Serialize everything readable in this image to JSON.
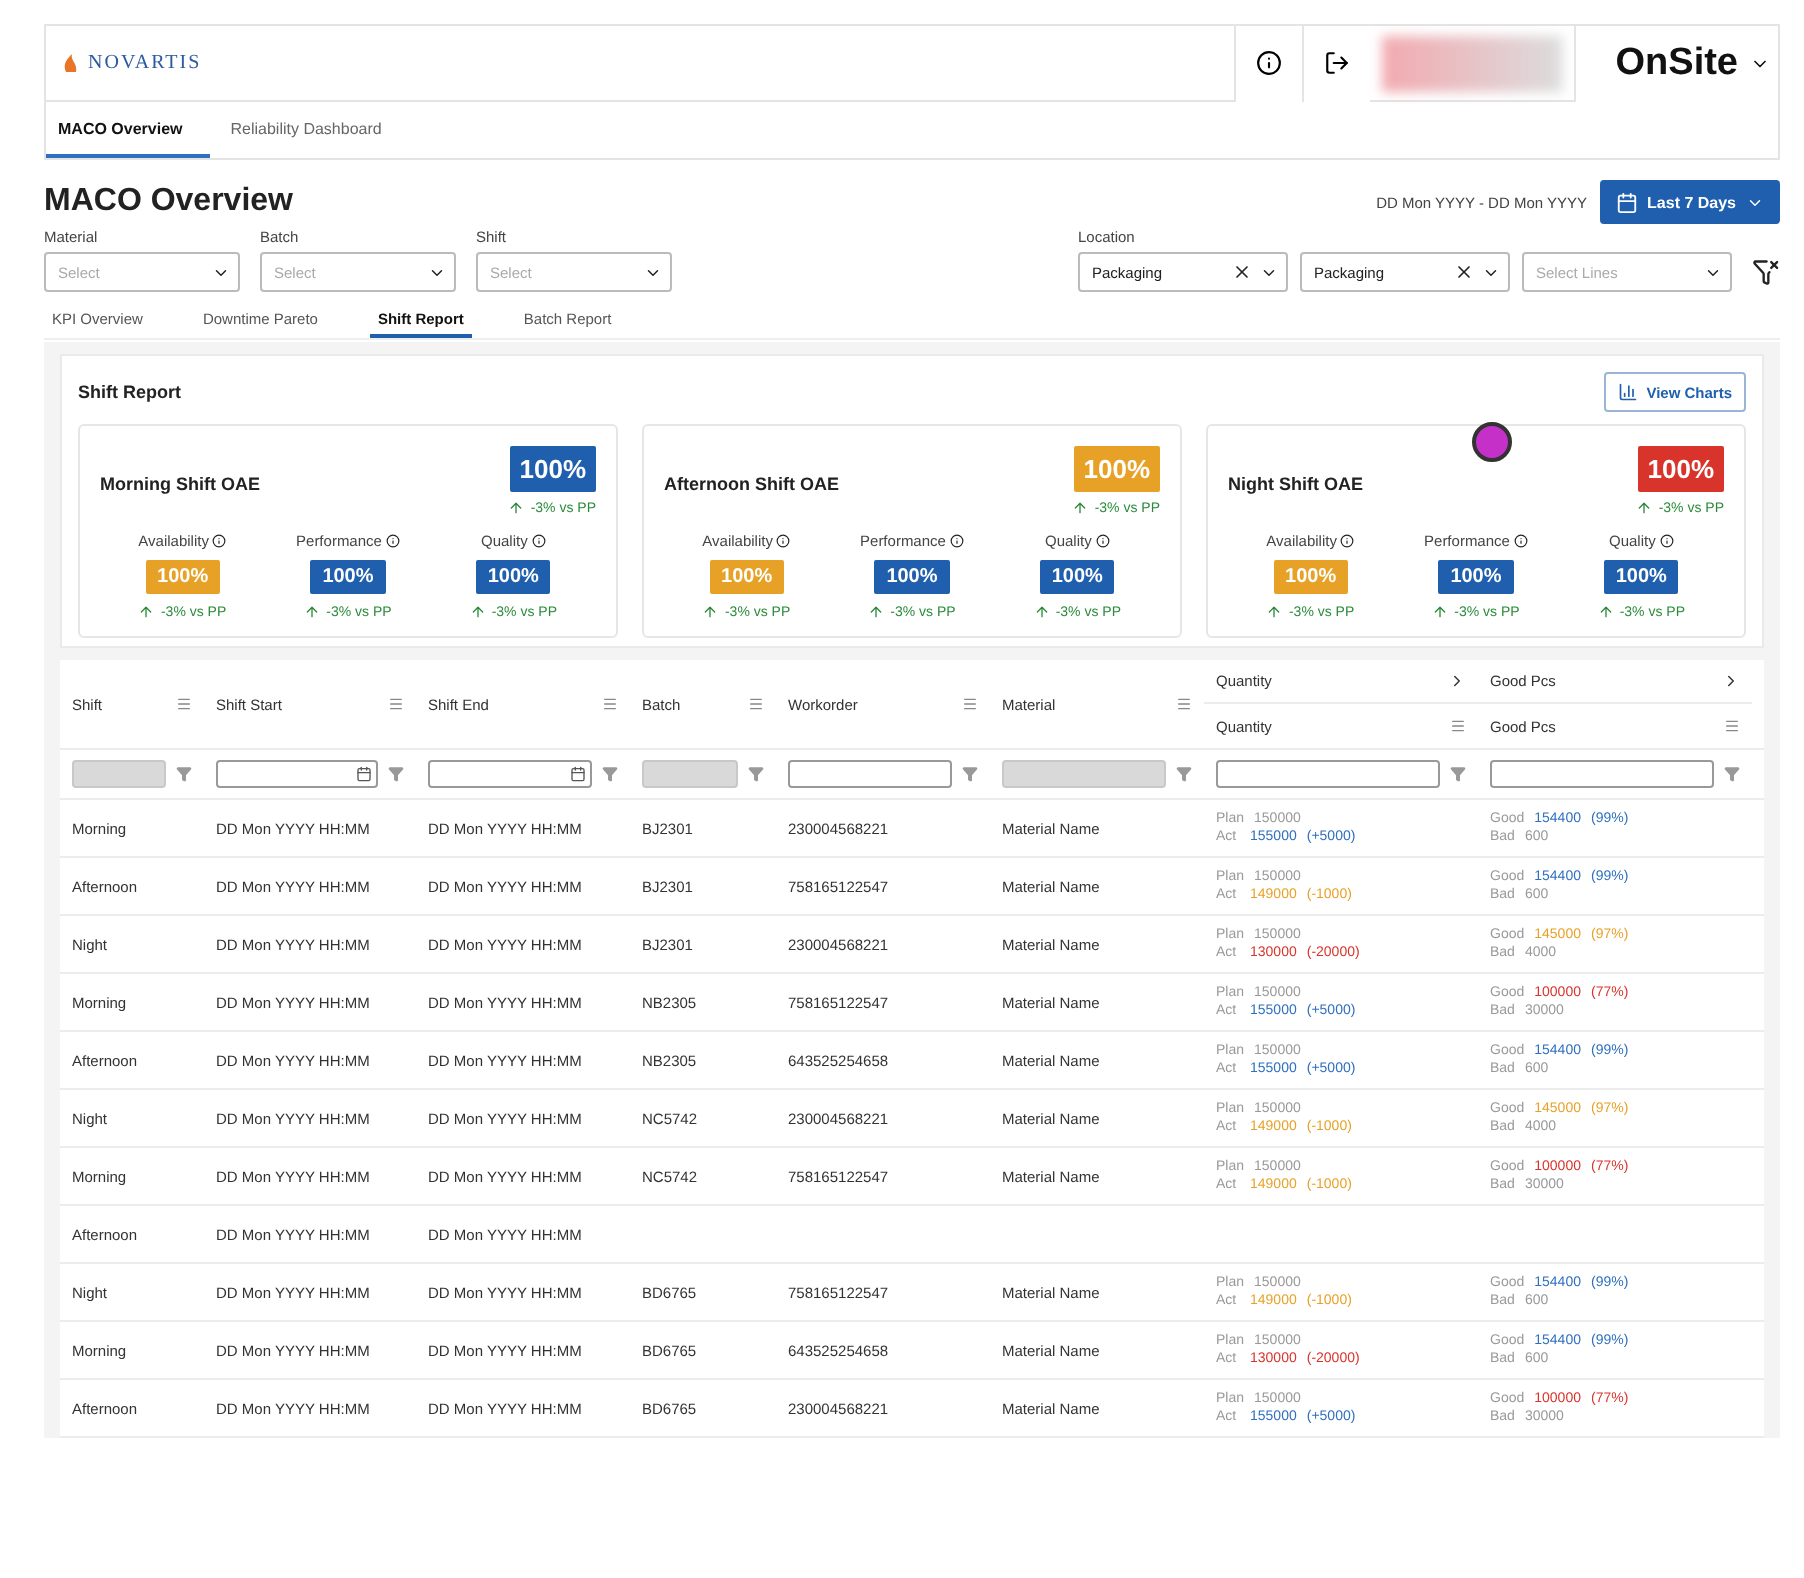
{
  "header": {
    "logo": "NOVARTIS",
    "app_name": "OnSite"
  },
  "nav_tabs": [
    {
      "label": "MACO Overview",
      "selected": true
    },
    {
      "label": "Reliability Dashboard",
      "selected": false
    }
  ],
  "page_title": "MACO Overview",
  "date_range": "DD Mon YYYY - DD Mon YYYY",
  "period_button": "Last 7 Days",
  "filters": [
    {
      "label": "Material",
      "placeholder": "Select"
    },
    {
      "label": "Batch",
      "placeholder": "Select"
    },
    {
      "label": "Shift",
      "placeholder": "Select"
    }
  ],
  "location": {
    "label": "Location",
    "selects": [
      {
        "value": "Packaging",
        "clearable": true
      },
      {
        "value": "Packaging",
        "clearable": true
      },
      {
        "placeholder": "Select Lines",
        "clearable": false
      }
    ]
  },
  "sub_tabs": [
    {
      "label": "KPI Overview",
      "selected": false
    },
    {
      "label": "Downtime Pareto",
      "selected": false
    },
    {
      "label": "Shift Report",
      "selected": true
    },
    {
      "label": "Batch Report",
      "selected": false
    }
  ],
  "report": {
    "title": "Shift Report",
    "charts_button": "View Charts",
    "cards": [
      {
        "title": "Morning Shift OAE",
        "value": "100%",
        "color": "#1f5fae",
        "delta": "-3% vs PP",
        "assistant": false,
        "metrics": [
          {
            "label": "Availability",
            "value": "100%",
            "color": "#e8a127",
            "delta": "-3% vs PP"
          },
          {
            "label": "Performance",
            "value": "100%",
            "color": "#1f5fae",
            "delta": "-3% vs PP"
          },
          {
            "label": "Quality",
            "value": "100%",
            "color": "#1f5fae",
            "delta": "-3% vs PP"
          }
        ]
      },
      {
        "title": "Afternoon Shift OAE",
        "value": "100%",
        "color": "#e8a127",
        "delta": "-3% vs PP",
        "assistant": false,
        "metrics": [
          {
            "label": "Availability",
            "value": "100%",
            "color": "#e8a127",
            "delta": "-3% vs PP"
          },
          {
            "label": "Performance",
            "value": "100%",
            "color": "#1f5fae",
            "delta": "-3% vs PP"
          },
          {
            "label": "Quality",
            "value": "100%",
            "color": "#1f5fae",
            "delta": "-3% vs PP"
          }
        ]
      },
      {
        "title": "Night Shift OAE",
        "value": "100%",
        "color": "#d9342b",
        "delta": "-3% vs PP",
        "assistant": true,
        "metrics": [
          {
            "label": "Availability",
            "value": "100%",
            "color": "#e8a127",
            "delta": "-3% vs PP"
          },
          {
            "label": "Performance",
            "value": "100%",
            "color": "#1f5fae",
            "delta": "-3% vs PP"
          },
          {
            "label": "Quality",
            "value": "100%",
            "color": "#1f5fae",
            "delta": "-3% vs PP"
          }
        ]
      }
    ]
  },
  "table": {
    "columns": [
      {
        "label": "Shift",
        "kind": "text",
        "disabled": true
      },
      {
        "label": "Shift Start",
        "kind": "date",
        "disabled": false
      },
      {
        "label": "Shift End",
        "kind": "date",
        "disabled": false
      },
      {
        "label": "Batch",
        "kind": "text",
        "disabled": true
      },
      {
        "label": "Workorder",
        "kind": "text",
        "disabled": false
      },
      {
        "label": "Material",
        "kind": "text",
        "disabled": true
      }
    ],
    "groups": [
      {
        "label": "Quantity",
        "sub": "Quantity"
      },
      {
        "label": "Good Pcs",
        "sub": "Good Pcs"
      }
    ],
    "rows": [
      {
        "shift": "Morning",
        "start": "DD Mon YYYY HH:MM",
        "end": "DD Mon YYYY HH:MM",
        "batch": "BJ2301",
        "workorder": "230004568221",
        "material": "Material Name",
        "plan_label": "Plan",
        "plan": "150000",
        "act_label": "Act",
        "act": {
          "value": "155000",
          "diff": "(+5000)",
          "color": "#2f6fc0"
        },
        "good_label": "Good",
        "good": {
          "value": "154400",
          "pct": "(99%)",
          "color": "#2f6fc0"
        },
        "bad_label": "Bad",
        "bad": "600"
      },
      {
        "shift": "Afternoon",
        "start": "DD Mon YYYY HH:MM",
        "end": "DD Mon YYYY HH:MM",
        "batch": "BJ2301",
        "workorder": "758165122547",
        "material": "Material Name",
        "plan_label": "Plan",
        "plan": "150000",
        "act_label": "Act",
        "act": {
          "value": "149000",
          "diff": "(-1000)",
          "color": "#e8a127"
        },
        "good_label": "Good",
        "good": {
          "value": "154400",
          "pct": "(99%)",
          "color": "#2f6fc0"
        },
        "bad_label": "Bad",
        "bad": "600"
      },
      {
        "shift": "Night",
        "start": "DD Mon YYYY HH:MM",
        "end": "DD Mon YYYY HH:MM",
        "batch": "BJ2301",
        "workorder": "230004568221",
        "material": "Material Name",
        "plan_label": "Plan",
        "plan": "150000",
        "act_label": "Act",
        "act": {
          "value": "130000",
          "diff": "(-20000)",
          "color": "#d9342b"
        },
        "good_label": "Good",
        "good": {
          "value": "145000",
          "pct": "(97%)",
          "color": "#e8a127"
        },
        "bad_label": "Bad",
        "bad": "4000"
      },
      {
        "shift": "Morning",
        "start": "DD Mon YYYY HH:MM",
        "end": "DD Mon YYYY HH:MM",
        "batch": "NB2305",
        "workorder": "758165122547",
        "material": "Material Name",
        "plan_label": "Plan",
        "plan": "150000",
        "act_label": "Act",
        "act": {
          "value": "155000",
          "diff": "(+5000)",
          "color": "#2f6fc0"
        },
        "good_label": "Good",
        "good": {
          "value": "100000",
          "pct": "(77%)",
          "color": "#d9342b"
        },
        "bad_label": "Bad",
        "bad": "30000"
      },
      {
        "shift": "Afternoon",
        "start": "DD Mon YYYY HH:MM",
        "end": "DD Mon YYYY HH:MM",
        "batch": "NB2305",
        "workorder": "643525254658",
        "material": "Material Name",
        "plan_label": "Plan",
        "plan": "150000",
        "act_label": "Act",
        "act": {
          "value": "155000",
          "diff": "(+5000)",
          "color": "#2f6fc0"
        },
        "good_label": "Good",
        "good": {
          "value": "154400",
          "pct": "(99%)",
          "color": "#2f6fc0"
        },
        "bad_label": "Bad",
        "bad": "600"
      },
      {
        "shift": "Night",
        "start": "DD Mon YYYY HH:MM",
        "end": "DD Mon YYYY HH:MM",
        "batch": "NC5742",
        "workorder": "230004568221",
        "material": "Material Name",
        "plan_label": "Plan",
        "plan": "150000",
        "act_label": "Act",
        "act": {
          "value": "149000",
          "diff": "(-1000)",
          "color": "#e8a127"
        },
        "good_label": "Good",
        "good": {
          "value": "145000",
          "pct": "(97%)",
          "color": "#e8a127"
        },
        "bad_label": "Bad",
        "bad": "4000"
      },
      {
        "shift": "Morning",
        "start": "DD Mon YYYY HH:MM",
        "end": "DD Mon YYYY HH:MM",
        "batch": "NC5742",
        "workorder": "758165122547",
        "material": "Material Name",
        "plan_label": "Plan",
        "plan": "150000",
        "act_label": "Act",
        "act": {
          "value": "149000",
          "diff": "(-1000)",
          "color": "#e8a127"
        },
        "good_label": "Good",
        "good": {
          "value": "100000",
          "pct": "(77%)",
          "color": "#d9342b"
        },
        "bad_label": "Bad",
        "bad": "30000"
      },
      {
        "shift": "Afternoon",
        "start": "DD Mon YYYY HH:MM",
        "end": "DD Mon YYYY HH:MM"
      },
      {
        "shift": "Night",
        "start": "DD Mon YYYY HH:MM",
        "end": "DD Mon YYYY HH:MM",
        "batch": "BD6765",
        "workorder": "758165122547",
        "material": "Material Name",
        "plan_label": "Plan",
        "plan": "150000",
        "act_label": "Act",
        "act": {
          "value": "149000",
          "diff": "(-1000)",
          "color": "#e8a127"
        },
        "good_label": "Good",
        "good": {
          "value": "154400",
          "pct": "(99%)",
          "color": "#2f6fc0"
        },
        "bad_label": "Bad",
        "bad": "600"
      },
      {
        "shift": "Morning",
        "start": "DD Mon YYYY HH:MM",
        "end": "DD Mon YYYY HH:MM",
        "batch": "BD6765",
        "workorder": "643525254658",
        "material": "Material Name",
        "plan_label": "Plan",
        "plan": "150000",
        "act_label": "Act",
        "act": {
          "value": "130000",
          "diff": "(-20000)",
          "color": "#d9342b"
        },
        "good_label": "Good",
        "good": {
          "value": "154400",
          "pct": "(99%)",
          "color": "#2f6fc0"
        },
        "bad_label": "Bad",
        "bad": "600"
      },
      {
        "shift": "Afternoon",
        "start": "DD Mon YYYY HH:MM",
        "end": "DD Mon YYYY HH:MM",
        "batch": "BD6765",
        "workorder": "230004568221",
        "material": "Material Name",
        "plan_label": "Plan",
        "plan": "150000",
        "act_label": "Act",
        "act": {
          "value": "155000",
          "diff": "(+5000)",
          "color": "#2f6fc0"
        },
        "good_label": "Good",
        "good": {
          "value": "100000",
          "pct": "(77%)",
          "color": "#d9342b"
        },
        "bad_label": "Bad",
        "bad": "30000"
      }
    ]
  }
}
